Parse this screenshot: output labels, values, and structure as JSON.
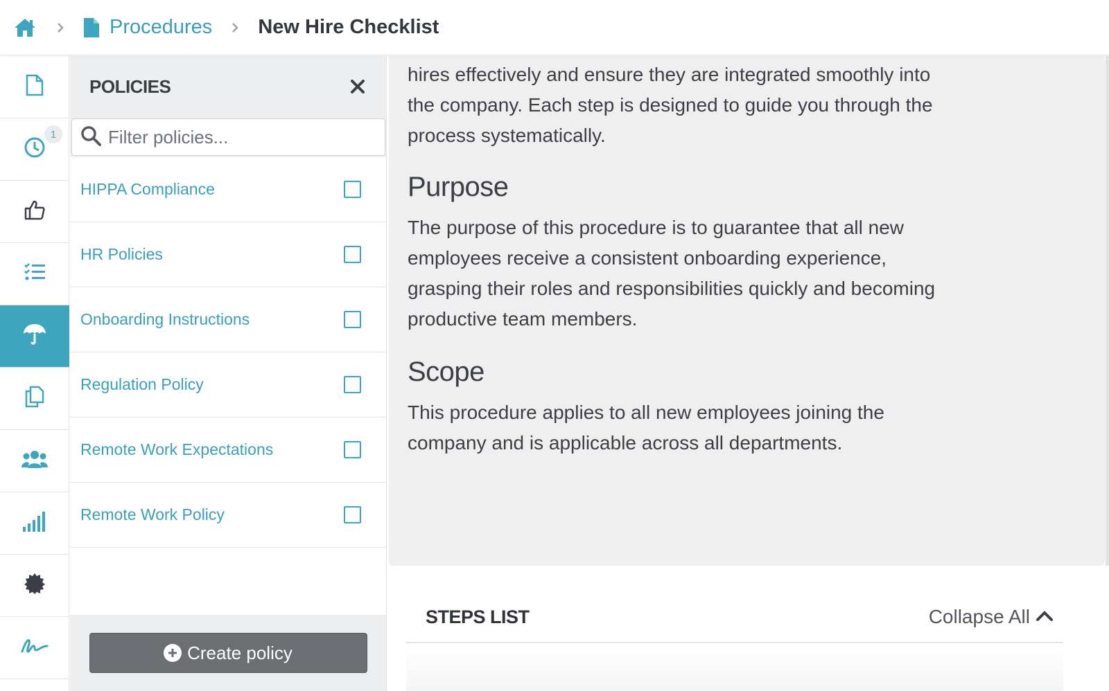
{
  "breadcrumb": {
    "home_icon": "home-icon",
    "section": "Procedures",
    "current": "New Hire Checklist"
  },
  "rail": {
    "items": [
      {
        "icon": "file-icon"
      },
      {
        "icon": "clock-icon",
        "badge": "1"
      },
      {
        "icon": "thumbs-up-icon"
      },
      {
        "icon": "checklist-icon"
      },
      {
        "icon": "umbrella-icon",
        "active": true
      },
      {
        "icon": "copy-icon"
      },
      {
        "icon": "users-icon"
      },
      {
        "icon": "signal-bars-icon"
      },
      {
        "icon": "certificate-icon"
      },
      {
        "icon": "signature-icon"
      }
    ]
  },
  "policies": {
    "title": "POLICIES",
    "filter_placeholder": "Filter policies...",
    "items": [
      {
        "label": "HIPPA Compliance",
        "checked": false
      },
      {
        "label": "HR Policies",
        "checked": false
      },
      {
        "label": "Onboarding Instructions",
        "checked": false
      },
      {
        "label": "Regulation Policy",
        "checked": false
      },
      {
        "label": "Remote Work Expectations",
        "checked": false
      },
      {
        "label": "Remote Work Policy",
        "checked": false
      }
    ],
    "create_label": "Create policy"
  },
  "document": {
    "intro": "hires effectively and ensure they are integrated smoothly into the company. Each step is designed to guide you through the process systematically.",
    "purpose_heading": "Purpose",
    "purpose_text": "The purpose of this procedure is to guarantee that all new employees receive a consistent onboarding experience, grasping their roles and responsibilities quickly and becoming productive team members.",
    "scope_heading": "Scope",
    "scope_text": "This procedure applies to all new employees joining the company and is applicable across all departments."
  },
  "steps": {
    "title": "STEPS LIST",
    "collapse_label": "Collapse All"
  },
  "colors": {
    "accent": "#3ea5be",
    "link": "#3aa0b7",
    "button": "#6b6e73"
  }
}
